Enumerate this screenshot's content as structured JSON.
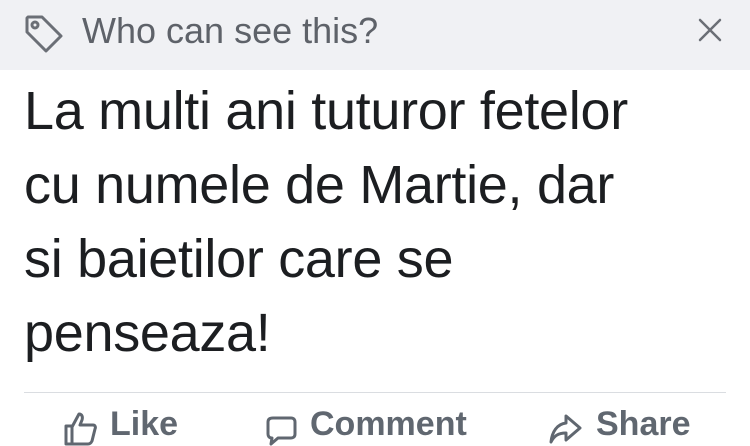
{
  "privacy": {
    "icon": "tag-icon",
    "label": "Who can see this?",
    "close_icon": "close-icon"
  },
  "post": {
    "text": "La multi ani tuturor fetelor\ncu numele de Martie, dar\nsi baietilor care se\npenseaza!"
  },
  "actions": {
    "like": {
      "label": "Like",
      "icon": "thumbs-up-icon"
    },
    "comment": {
      "label": "Comment",
      "icon": "comment-icon"
    },
    "share": {
      "label": "Share",
      "icon": "share-icon"
    }
  },
  "colors": {
    "privacy_bar_bg": "#f0f1f4",
    "text_primary": "#1c1e21",
    "text_secondary": "#5e6269",
    "action_text": "#606770",
    "divider": "#dadde1"
  }
}
